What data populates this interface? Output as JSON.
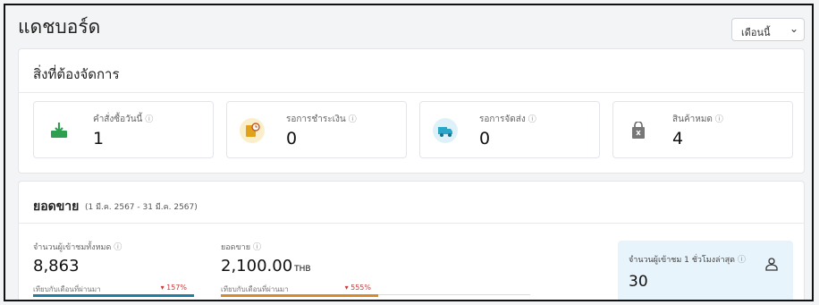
{
  "page": {
    "title": "แดชบอร์ด"
  },
  "period_select": {
    "value": "เดือนนี้"
  },
  "todo": {
    "heading": "สิ่งที่ต้องจัดการ",
    "tiles": [
      {
        "label": "คำสั่งซื้อวันนี้",
        "value": "1",
        "icon": "inbox-download-icon",
        "color": "#2e9e4f"
      },
      {
        "label": "รอการชำระเงิน",
        "value": "0",
        "icon": "payment-pending-icon",
        "color": "#e0a21a"
      },
      {
        "label": "รอการจัดส่ง",
        "value": "0",
        "icon": "delivery-truck-icon",
        "color": "#2aa6c9"
      },
      {
        "label": "สินค้าหมด",
        "value": "4",
        "icon": "empty-box-icon",
        "color": "#666666"
      }
    ]
  },
  "sales": {
    "heading": "ยอดขาย",
    "date_range": "(1 มี.ค. 2567 - 31 มี.ค. 2567)",
    "metrics": [
      {
        "label": "จำนวนผู้เข้าชมทั้งหมด",
        "value": "8,863",
        "unit": "",
        "compare_label": "เทียบกับเดือนที่ผ่านมา",
        "change": "▾ 157%",
        "bar_color": "#1f7ea1"
      },
      {
        "label": "ยอดขาย",
        "value": "2,100.00",
        "unit": "THB",
        "compare_label": "เทียบกับเดือนที่ผ่านมา",
        "change": "▾ 555%",
        "bar_color": "#d8892a"
      }
    ],
    "online": {
      "label": "จำนวนผู้เข้าชม 1 ชั่วโมงล่าสุด",
      "value": "30",
      "icon": "user-icon"
    }
  },
  "help_icon": "ⓘ"
}
